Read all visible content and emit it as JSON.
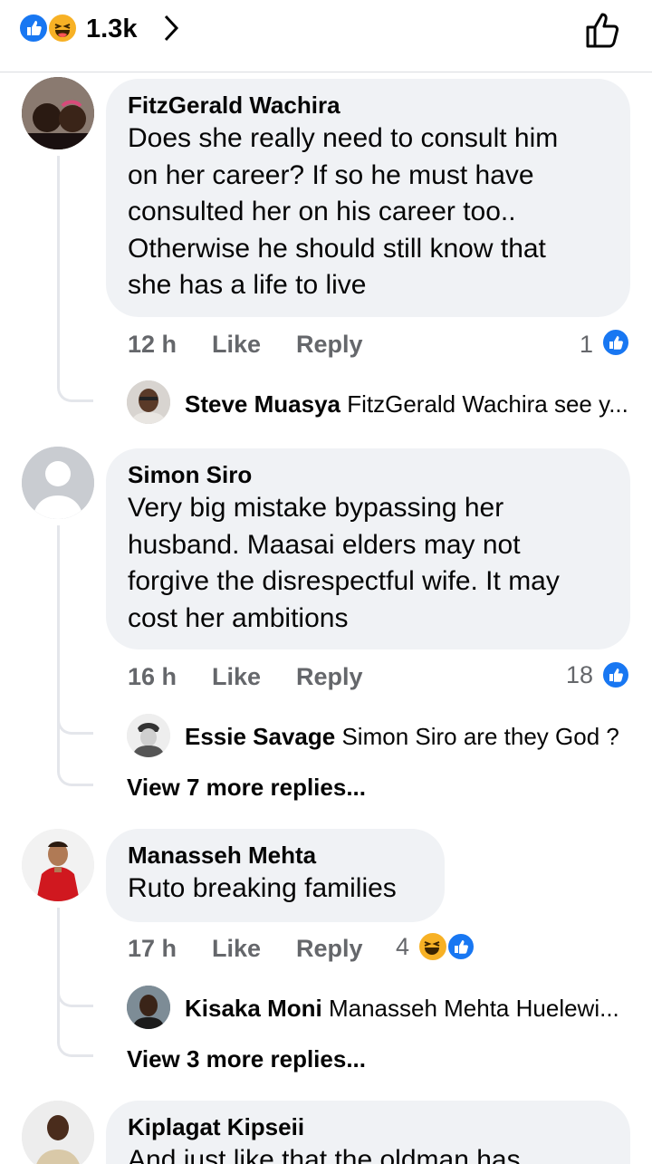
{
  "header": {
    "reaction_count": "1.3k"
  },
  "comments": [
    {
      "author": "FitzGerald Wachira",
      "lines": [
        "Does she really need to consult him",
        "on her career? If so he must have",
        "consulted her on his career too..",
        "Otherwise he should still know that",
        "she has a life to live"
      ],
      "time": "12 h",
      "like": "Like",
      "reply": "Reply",
      "reactions": "1",
      "replies": [
        {
          "author": "Steve Muasya",
          "text": "FitzGerald Wachira see y..."
        }
      ]
    },
    {
      "author": "Simon Siro",
      "lines": [
        "Very big mistake bypassing her",
        "husband. Maasai elders may not",
        "forgive the disrespectful wife. It may",
        "cost her ambitions"
      ],
      "time": "16 h",
      "like": "Like",
      "reply": "Reply",
      "reactions": "18",
      "replies": [
        {
          "author": "Essie Savage",
          "text": "Simon Siro are they God ?"
        }
      ],
      "more": "View 7 more replies..."
    },
    {
      "author": "Manasseh Mehta",
      "lines": [
        "Ruto breaking families"
      ],
      "time": "17 h",
      "like": "Like",
      "reply": "Reply",
      "reactions": "4",
      "replies": [
        {
          "author": "Kisaka Moni",
          "text": "Manasseh Mehta Huelewi..."
        }
      ],
      "more": "View 3 more replies..."
    },
    {
      "author": "Kiplagat Kipseii",
      "lines": [
        "And just like that the oldman has"
      ]
    }
  ]
}
